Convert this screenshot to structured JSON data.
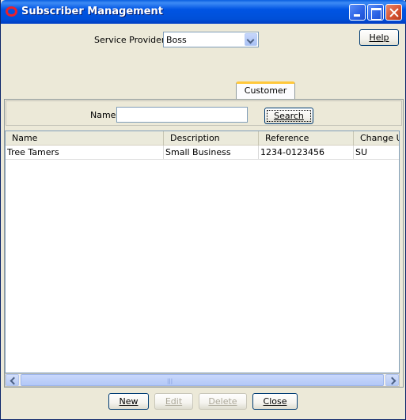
{
  "window": {
    "title": "Subscriber Management"
  },
  "form": {
    "service_provider_label": "Service Provider",
    "service_provider_value": "Boss",
    "help_label": "Help",
    "tab_label": "Customer",
    "name_label": "Name",
    "name_value": "",
    "search_label": "Search"
  },
  "table": {
    "columns": [
      "Name",
      "Description",
      "Reference",
      "Change Us"
    ],
    "rows": [
      [
        "Tree Tamers",
        "Small Business",
        "1234-0123456",
        "SU"
      ]
    ]
  },
  "actions": {
    "new_label": "New",
    "edit_label": "Edit",
    "delete_label": "Delete",
    "close_label": "Close"
  },
  "colors": {
    "titlebar": "#0054e3",
    "tab_accent": "#ffc83c",
    "window_bg": "#ece9d8"
  }
}
